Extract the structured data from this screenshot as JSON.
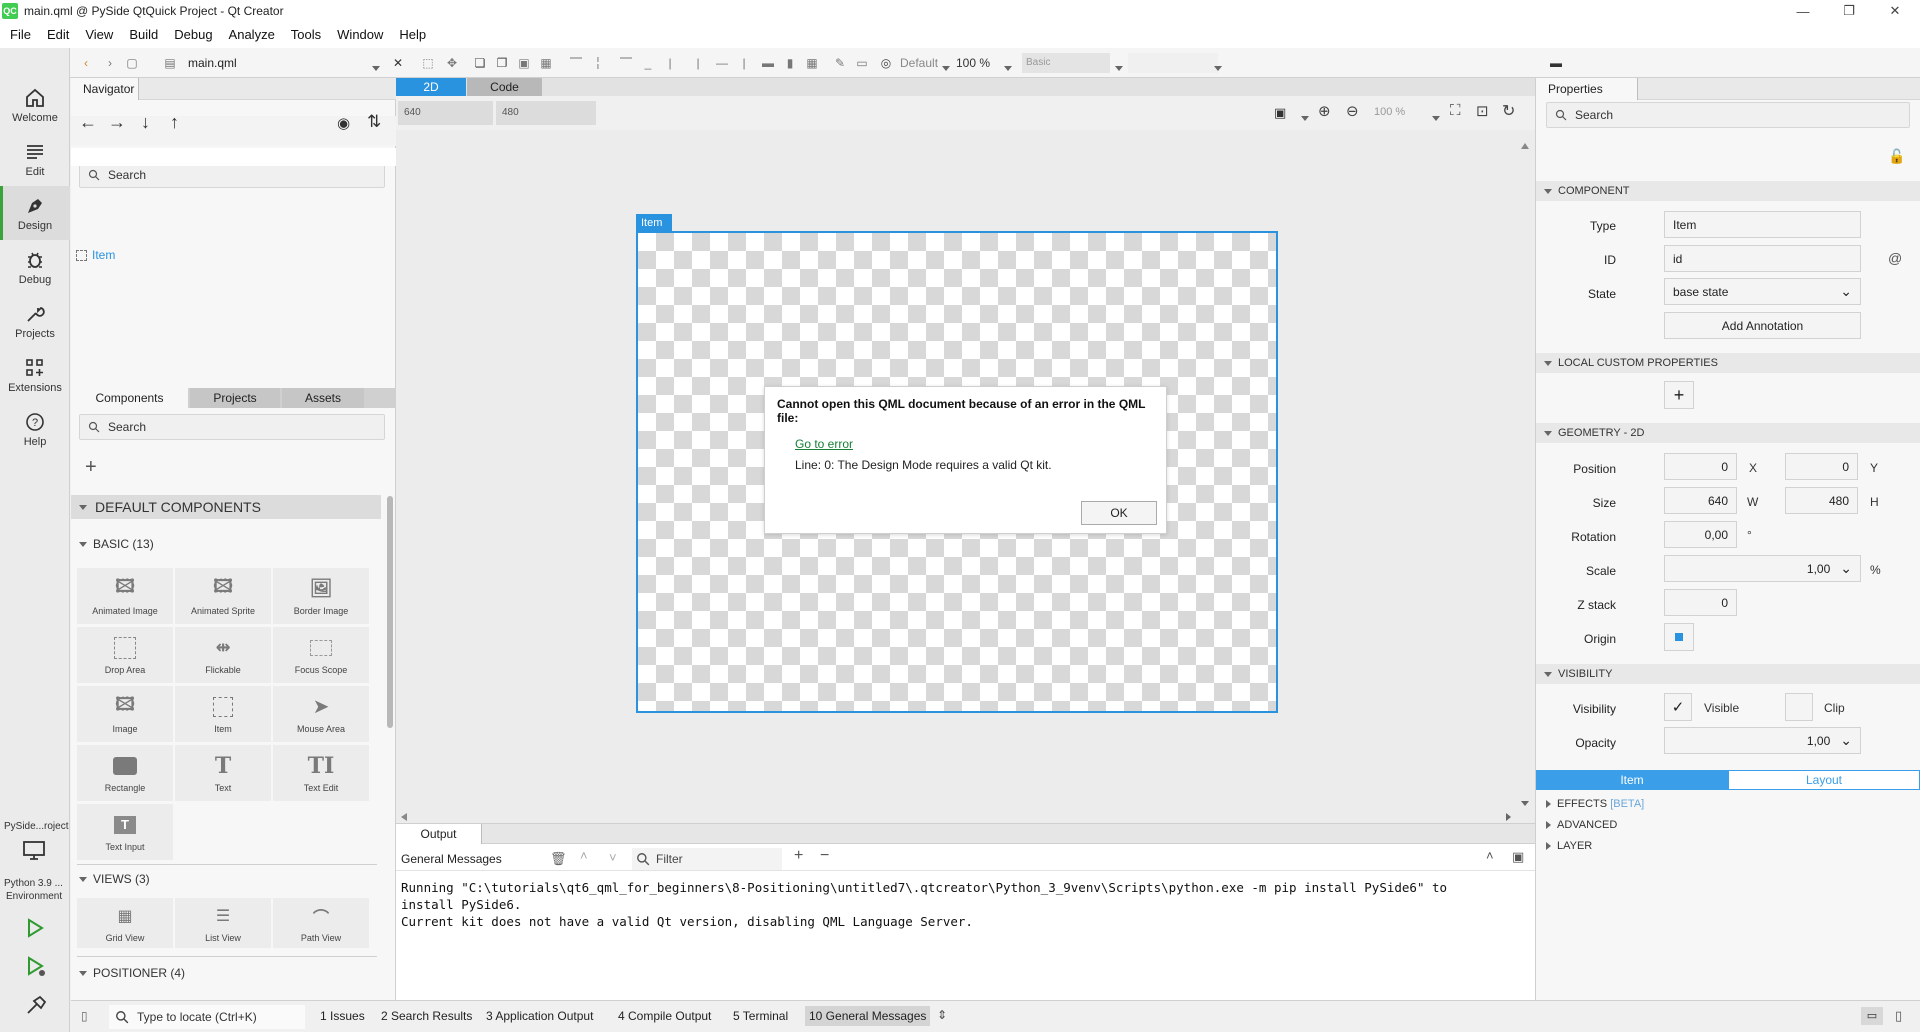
{
  "window": {
    "title": "main.qml @ PySide QtQuick Project - Qt Creator",
    "icon_text": "QC"
  },
  "menu": [
    "File",
    "Edit",
    "View",
    "Build",
    "Debug",
    "Analyze",
    "Tools",
    "Window",
    "Help"
  ],
  "modes": [
    {
      "label": "Welcome",
      "icon": "home-icon"
    },
    {
      "label": "Edit",
      "icon": "edit-lines-icon"
    },
    {
      "label": "Design",
      "icon": "pen-icon"
    },
    {
      "label": "Debug",
      "icon": "bug-icon"
    },
    {
      "label": "Projects",
      "icon": "wrench-icon"
    },
    {
      "label": "Extensions",
      "icon": "extensions-icon"
    },
    {
      "label": "Help",
      "icon": "help-icon"
    }
  ],
  "kit": {
    "project": "PySide...roject",
    "name": "Python 3.9 ...",
    "env": "Environment"
  },
  "toolbar": {
    "file": "main.qml",
    "state": "Default",
    "zoom": "100 %",
    "style": "Basic"
  },
  "navigator": {
    "tab": "Navigator",
    "search": "Search",
    "root_item": "Item"
  },
  "components": {
    "tabs": [
      "Components",
      "Projects",
      "Assets"
    ],
    "search": "Search",
    "default_header": "DEFAULT COMPONENTS",
    "basic_header": "BASIC (13)",
    "basic": [
      "Animated Image",
      "Animated Sprite",
      "Border Image",
      "Drop Area",
      "Flickable",
      "Focus Scope",
      "Image",
      "Item",
      "Mouse Area",
      "Rectangle",
      "Text",
      "Text Edit",
      "Text Input"
    ],
    "views_header": "VIEWS (3)",
    "views": [
      "Grid View",
      "List View",
      "Path View"
    ],
    "positioner_header": "POSITIONER (4)"
  },
  "canvas": {
    "tab_2d": "2D",
    "tab_code": "Code",
    "width": "640",
    "height": "480",
    "zoom": "100 %",
    "item_label": "Item"
  },
  "dialog": {
    "title": "Cannot open this QML document because of an error in the QML file:",
    "link": "Go to error",
    "message": "Line: 0: The Design Mode requires a valid Qt kit.",
    "ok": "OK"
  },
  "output": {
    "tab": "Output",
    "pane": "General Messages",
    "filter": "Filter",
    "lines": [
      "Running \"C:\\tutorials\\qt6_qml_for_beginners\\8-Positioning\\untitled7\\.qtcreator\\Python_3_9venv\\Scripts\\python.exe -m pip install PySide6\" to",
      "install PySide6.",
      "Current kit does not have a valid Qt version, disabling QML Language Server."
    ]
  },
  "properties": {
    "tab": "Properties",
    "search": "Search",
    "component_header": "COMPONENT",
    "type_label": "Type",
    "type_value": "Item",
    "id_label": "ID",
    "id_value": "id",
    "id_suffix": "@",
    "state_label": "State",
    "state_value": "base state",
    "add_annotation": "Add Annotation",
    "local_header": "LOCAL CUSTOM PROPERTIES",
    "geometry_header": "GEOMETRY - 2D",
    "position_label": "Position",
    "pos_x": "0",
    "pos_y": "0",
    "x_unit": "X",
    "y_unit": "Y",
    "size_label": "Size",
    "size_w": "640",
    "size_h": "480",
    "w_unit": "W",
    "h_unit": "H",
    "rotation_label": "Rotation",
    "rotation": "0,00",
    "rotation_unit": "°",
    "scale_label": "Scale",
    "scale": "1,00",
    "scale_unit": "%",
    "zstack_label": "Z stack",
    "zstack": "0",
    "origin_label": "Origin",
    "visibility_header": "VISIBILITY",
    "visibility_label": "Visibility",
    "visible": "Visible",
    "clip": "Clip",
    "opacity_label": "Opacity",
    "opacity": "1,00",
    "tab_item": "Item",
    "tab_layout": "Layout",
    "effects": "EFFECTS",
    "beta": "[BETA]",
    "advanced": "ADVANCED",
    "layer": "LAYER"
  },
  "status": {
    "locate": "Type to locate (Ctrl+K)",
    "items": [
      "1  Issues",
      "2  Search Results",
      "3  Application Output",
      "4  Compile Output",
      "5  Terminal",
      "10  General Messages"
    ]
  },
  "colors": {
    "accent": "#2a93e0",
    "active_mode": "#3aa33a",
    "link": "#1a7f37"
  }
}
